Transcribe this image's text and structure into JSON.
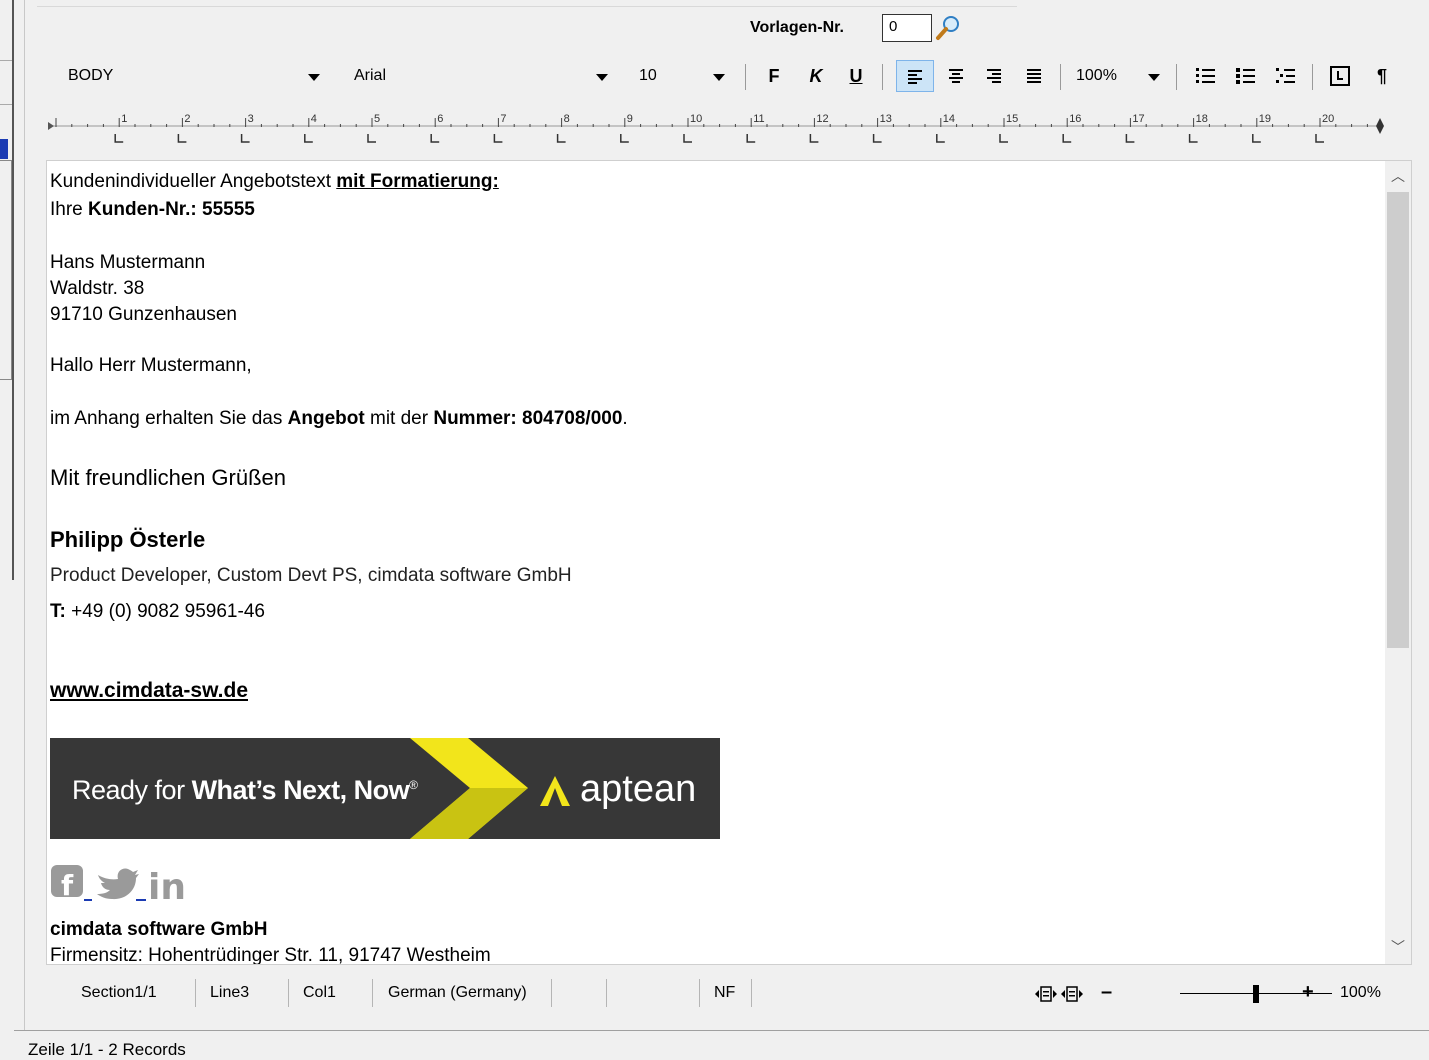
{
  "header": {
    "vorlagen_label": "Vorlagen-Nr.",
    "vorlagen_value": "0"
  },
  "toolbar": {
    "style": "BODY",
    "font": "Arial",
    "size": "10",
    "bold": "F",
    "italic": "K",
    "underline": "U",
    "zoom": "100%",
    "paragraph_mark": "¶"
  },
  "ruler": {
    "numbers": [
      "1",
      "2",
      "3",
      "4",
      "5",
      "6",
      "7",
      "8",
      "9",
      "10",
      "11",
      "12",
      "13",
      "14",
      "15",
      "16",
      "17",
      "18",
      "19",
      "20"
    ]
  },
  "document": {
    "line1_a": "Kundenindividueller Angebotstext ",
    "line1_b": "mit Formatierung:",
    "line2_a": "Ihre ",
    "line2_b": "Kunden-Nr.: 55555",
    "addr1": "Hans Mustermann",
    "addr2": "Waldstr. 38",
    "addr3": "91710 Gunzenhausen",
    "greeting": "Hallo Herr Mustermann,",
    "body_a": "im Anhang erhalten Sie das ",
    "body_b": "Angebot",
    "body_c": " mit der ",
    "body_d": "Nummer: 804708/000",
    "body_e": ".",
    "closing": "Mit freundlichen Grüßen",
    "sig_name": "Philipp Österle",
    "sig_title": "Product Developer, Custom Devt PS, cimdata software GmbH",
    "sig_phone_label": "T:",
    "sig_phone": " +49 (0) 9082 95961-46",
    "website": "www.cimdata-sw.de",
    "banner_tag_a": "Ready for ",
    "banner_tag_b": "What’s Next, Now",
    "banner_tag_reg": "®",
    "banner_brand": "aptean",
    "social_in": "in",
    "company": "cimdata software GmbH",
    "company_addr": "Firmensitz: Hohentrüdinger Str. 11, 91747 Westheim"
  },
  "statusbar": {
    "section": "Section1/1",
    "line": "Line3",
    "col": "Col1",
    "language": "German (Germany)",
    "nf": "NF",
    "zoom_minus": "–",
    "zoom_plus": "+",
    "zoom": "100%",
    "zoom_level_fraction": 0.5
  },
  "footer": {
    "records": "Zeile 1/1 - 2 Records"
  },
  "colors": {
    "accent": "#cce4f7",
    "banner_bg": "#373737",
    "banner_yellow": "#f2e51b",
    "social_grey": "#9a9a9a",
    "selection_blue": "#1b3bb3"
  },
  "icons": [
    "magnifier-icon",
    "dropdown-arrow-icon",
    "align-left-icon",
    "align-center-icon",
    "align-right-icon",
    "justify-icon",
    "numbered-list-icon",
    "bullet-list-icon",
    "outline-list-icon",
    "tab-stop-icon",
    "pilcrow-icon",
    "facebook-icon",
    "twitter-icon",
    "linkedin-icon",
    "view-mode-icon",
    "scroll-up-icon",
    "scroll-down-icon"
  ]
}
